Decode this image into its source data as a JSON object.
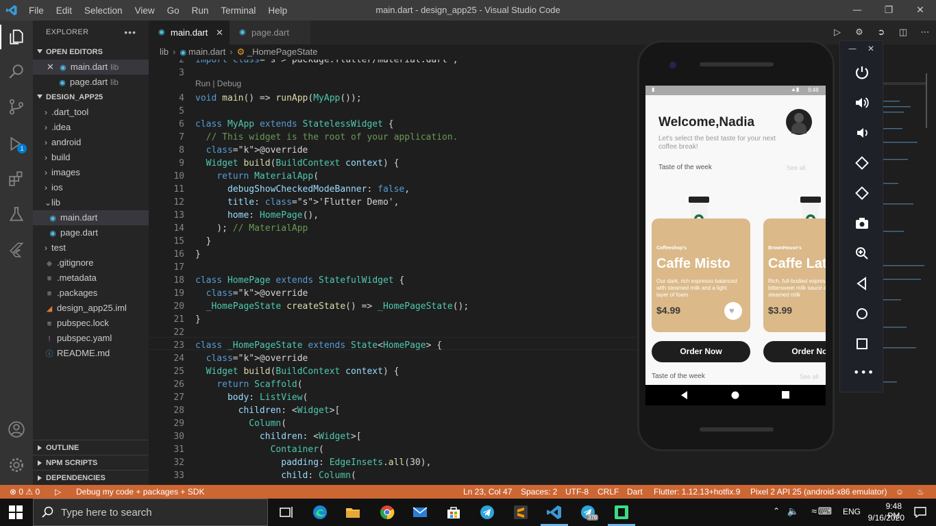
{
  "window": {
    "title": "main.dart - design_app25 - Visual Studio Code",
    "menu": [
      "File",
      "Edit",
      "Selection",
      "View",
      "Go",
      "Run",
      "Terminal",
      "Help"
    ]
  },
  "activity": {
    "debug_badge": "1"
  },
  "explorer": {
    "title": "EXPLORER",
    "open_editors_label": "OPEN EDITORS",
    "open_editors": [
      {
        "name": "main.dart",
        "sub": "lib"
      },
      {
        "name": "page.dart",
        "sub": "lib"
      }
    ],
    "project_label": "DESIGN_APP25",
    "tree": [
      {
        "name": ".dart_tool",
        "type": "folder"
      },
      {
        "name": ".idea",
        "type": "folder"
      },
      {
        "name": "android",
        "type": "folder"
      },
      {
        "name": "build",
        "type": "folder"
      },
      {
        "name": "images",
        "type": "folder"
      },
      {
        "name": "ios",
        "type": "folder"
      },
      {
        "name": "lib",
        "type": "folder-open"
      },
      {
        "name": "main.dart",
        "type": "dart"
      },
      {
        "name": "page.dart",
        "type": "dart"
      },
      {
        "name": "test",
        "type": "folder"
      },
      {
        "name": ".gitignore",
        "type": "file"
      },
      {
        "name": ".metadata",
        "type": "file"
      },
      {
        "name": ".packages",
        "type": "file"
      },
      {
        "name": "design_app25.iml",
        "type": "file"
      },
      {
        "name": "pubspec.lock",
        "type": "file"
      },
      {
        "name": "pubspec.yaml",
        "type": "file"
      },
      {
        "name": "README.md",
        "type": "file"
      }
    ],
    "outline_label": "OUTLINE",
    "npm_label": "NPM SCRIPTS",
    "deps_label": "DEPENDENCIES"
  },
  "tabs": [
    {
      "label": "main.dart",
      "active": true
    },
    {
      "label": "page.dart",
      "active": false
    }
  ],
  "breadcrumb": [
    "lib",
    "main.dart",
    "_HomePageState"
  ],
  "editor": {
    "codelens": "Run | Debug",
    "lines": [
      {
        "n": "2",
        "t": "import 'package:flutter/material.dart';"
      },
      {
        "n": "3",
        "t": ""
      },
      {
        "n": "4",
        "t": "void main() => runApp(MyApp());"
      },
      {
        "n": "5",
        "t": ""
      },
      {
        "n": "6",
        "t": "class MyApp extends StatelessWidget {"
      },
      {
        "n": "7",
        "t": "  // This widget is the root of your application."
      },
      {
        "n": "8",
        "t": "  @override"
      },
      {
        "n": "9",
        "t": "  Widget build(BuildContext context) {"
      },
      {
        "n": "10",
        "t": "    return MaterialApp("
      },
      {
        "n": "11",
        "t": "      debugShowCheckedModeBanner: false,"
      },
      {
        "n": "12",
        "t": "      title: 'Flutter Demo',"
      },
      {
        "n": "13",
        "t": "      home: HomePage(),"
      },
      {
        "n": "14",
        "t": "    ); // MaterialApp"
      },
      {
        "n": "15",
        "t": "  }"
      },
      {
        "n": "16",
        "t": "}"
      },
      {
        "n": "17",
        "t": ""
      },
      {
        "n": "18",
        "t": "class HomePage extends StatefulWidget {"
      },
      {
        "n": "19",
        "t": "  @override"
      },
      {
        "n": "20",
        "t": "  _HomePageState createState() => _HomePageState();"
      },
      {
        "n": "21",
        "t": "}"
      },
      {
        "n": "22",
        "t": ""
      },
      {
        "n": "23",
        "t": "class _HomePageState extends State<HomePage> {"
      },
      {
        "n": "24",
        "t": "  @override"
      },
      {
        "n": "25",
        "t": "  Widget build(BuildContext context) {"
      },
      {
        "n": "26",
        "t": "    return Scaffold("
      },
      {
        "n": "27",
        "t": "      body: ListView("
      },
      {
        "n": "28",
        "t": "        children: <Widget>["
      },
      {
        "n": "29",
        "t": "          Column("
      },
      {
        "n": "30",
        "t": "            children: <Widget>["
      },
      {
        "n": "31",
        "t": "              Container("
      },
      {
        "n": "32",
        "t": "                padding: EdgeInsets.all(30),"
      },
      {
        "n": "33",
        "t": "                child: Column("
      }
    ]
  },
  "status": {
    "problems": "⊗ 0 ⚠ 0",
    "debug": "Debug my code + packages + SDK",
    "position": "Ln 23, Col 47",
    "spaces": "Spaces: 2",
    "encoding": "UTF-8",
    "eol": "CRLF",
    "language": "Dart",
    "flutter": "Flutter: 1.12.13+hotfix.9",
    "device": "Pixel 2 API 25 (android-x86 emulator)"
  },
  "phone_app": {
    "time": "9:48",
    "welcome": "Welcome,Nadia",
    "subtitle": "Let's select the best taste for your next coffee break!",
    "section": "Taste of the week",
    "see_all": "See all",
    "cards": [
      {
        "shop": "Coffeeshop's",
        "name": "Caffe Misto",
        "desc": "Our dark, rich espresso balanced with steamed milk and a light layer of foam",
        "price": "$4.99",
        "button": "Order Now"
      },
      {
        "shop": "BrownHouse's",
        "name": "Caffe Latte",
        "desc": "Rich, full-bodied espresso with bittersweet milk sauce and steamed milk",
        "price": "$3.99",
        "button": "Order Now"
      }
    ],
    "section2": "Taste of the week",
    "see_all2": "See all"
  },
  "taskbar": {
    "search_placeholder": "Type here to search",
    "lang": "ENG",
    "time": "9:48 PM",
    "date": "9/16/2020",
    "telegram_badge": "376"
  },
  "colors": {
    "status_bar": "#cc6633",
    "card": "#dbb989",
    "accent": "#007acc"
  }
}
